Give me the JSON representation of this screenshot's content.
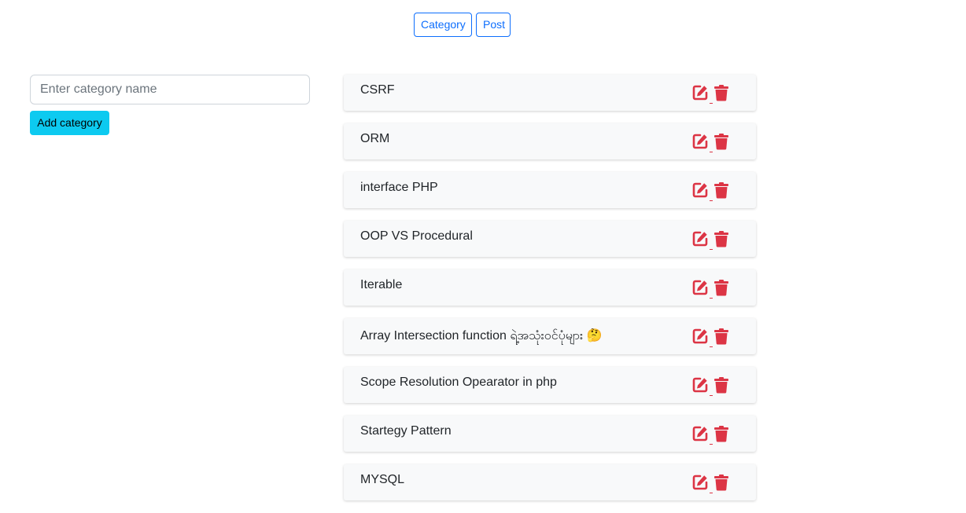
{
  "nav": {
    "category_label": "Category",
    "post_label": "Post"
  },
  "form": {
    "input_value": "",
    "input_placeholder": "Enter category name",
    "add_label": "Add category"
  },
  "colors": {
    "primary": "#0d6efd",
    "info": "#0dcaf0",
    "danger": "#dc3545"
  },
  "icons": {
    "edit": "edit-icon",
    "delete": "trash-icon"
  },
  "categories": [
    {
      "name": "CSRF"
    },
    {
      "name": "ORM"
    },
    {
      "name": "interface PHP"
    },
    {
      "name": "OOP VS Procedural"
    },
    {
      "name": "Iterable"
    },
    {
      "name": "Array Intersection function ရဲ့အသုံးဝင်ပုံများ 🤔"
    },
    {
      "name": "Scope Resolution Opearator in php"
    },
    {
      "name": "Startegy Pattern"
    },
    {
      "name": "MYSQL"
    }
  ]
}
